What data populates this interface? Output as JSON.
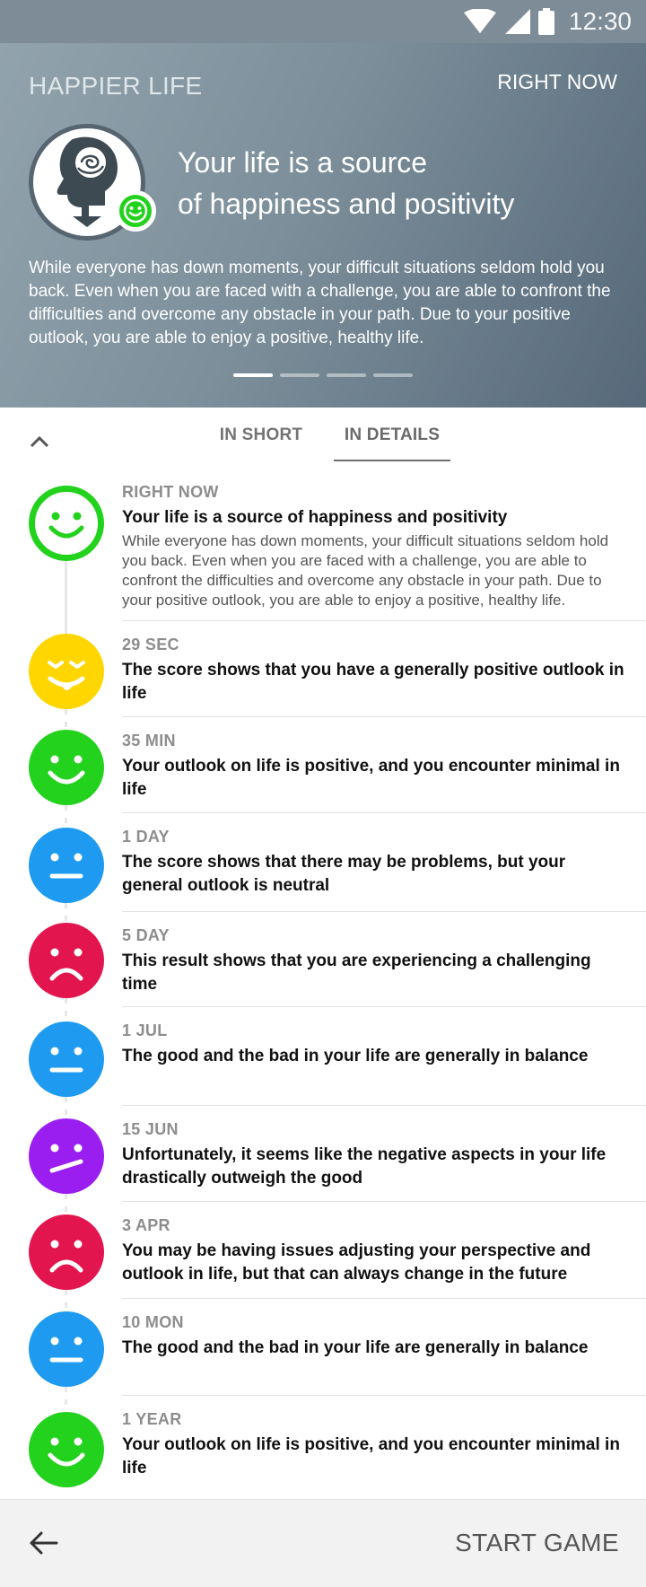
{
  "status_bar": {
    "time": "12:30",
    "icons": [
      "wifi-icon",
      "signal-icon",
      "battery-icon"
    ]
  },
  "hero": {
    "app_title": "HAPPIER LIFE",
    "right_now": "RIGHT NOW",
    "headline_line1": "Your life is a source",
    "headline_line2": "of happiness and positivity",
    "description": "While everyone has down moments, your difficult situations seldom hold you back. Even when you are faced with a challenge, you are able to confront the difficulties and overcome any obstacle in your path. Due to your positive outlook, you are able to enjoy a positive, healthy life.",
    "pager_total": 4,
    "pager_active": 1
  },
  "tabs": {
    "short": "IN SHORT",
    "details": "IN DETAILS",
    "active": "details"
  },
  "timeline": [
    {
      "when": "RIGHT NOW",
      "title": "Your life is a source of happiness and positivity",
      "desc": "While everyone has down moments, your difficult situations seldom hold you back. Even when you are faced with a challenge, you are able to confront the difficulties and overcome any obstacle in your path. Due to your positive outlook, you are able to enjoy a positive, healthy life.",
      "mood": "happy-outline",
      "color": "#23d21d"
    },
    {
      "when": "29 SEC",
      "title": "The score shows that you have a generally positive outlook in life",
      "mood": "playful",
      "color": "#ffd600"
    },
    {
      "when": "35 MIN",
      "title": "Your outlook on life is positive, and you encounter minimal in life",
      "mood": "happy",
      "color": "#23d21d"
    },
    {
      "when": "1 DAY",
      "title": "The score shows that there may be problems, but your general outlook is neutral",
      "mood": "neutral",
      "color": "#1e9bf0"
    },
    {
      "when": "5 DAY",
      "title": "This result shows that you are experiencing a challenging time",
      "mood": "sad",
      "color": "#e3154e"
    },
    {
      "when": "1 JUL",
      "title": "The good and the bad in your life are generally in balance",
      "mood": "neutral",
      "color": "#1e9bf0"
    },
    {
      "when": "15 JUN",
      "title": "Unfortunately, it seems like the negative aspects in your life drastically outweigh the good",
      "mood": "uneasy",
      "color": "#9b1ef0"
    },
    {
      "when": "3 APR",
      "title": "You may be having issues adjusting your perspective and outlook in life, but that can always change in the future",
      "mood": "sad",
      "color": "#e3154e"
    },
    {
      "when": "10 MON",
      "title": "The good and the bad in your life are generally in balance",
      "mood": "neutral",
      "color": "#1e9bf0"
    },
    {
      "when": "1 YEAR",
      "title": "Your outlook on life is positive, and you encounter minimal in life",
      "mood": "happy",
      "color": "#23d21d"
    }
  ],
  "bottom_bar": {
    "start_label": "START GAME",
    "back_icon": "arrow-left-icon"
  }
}
